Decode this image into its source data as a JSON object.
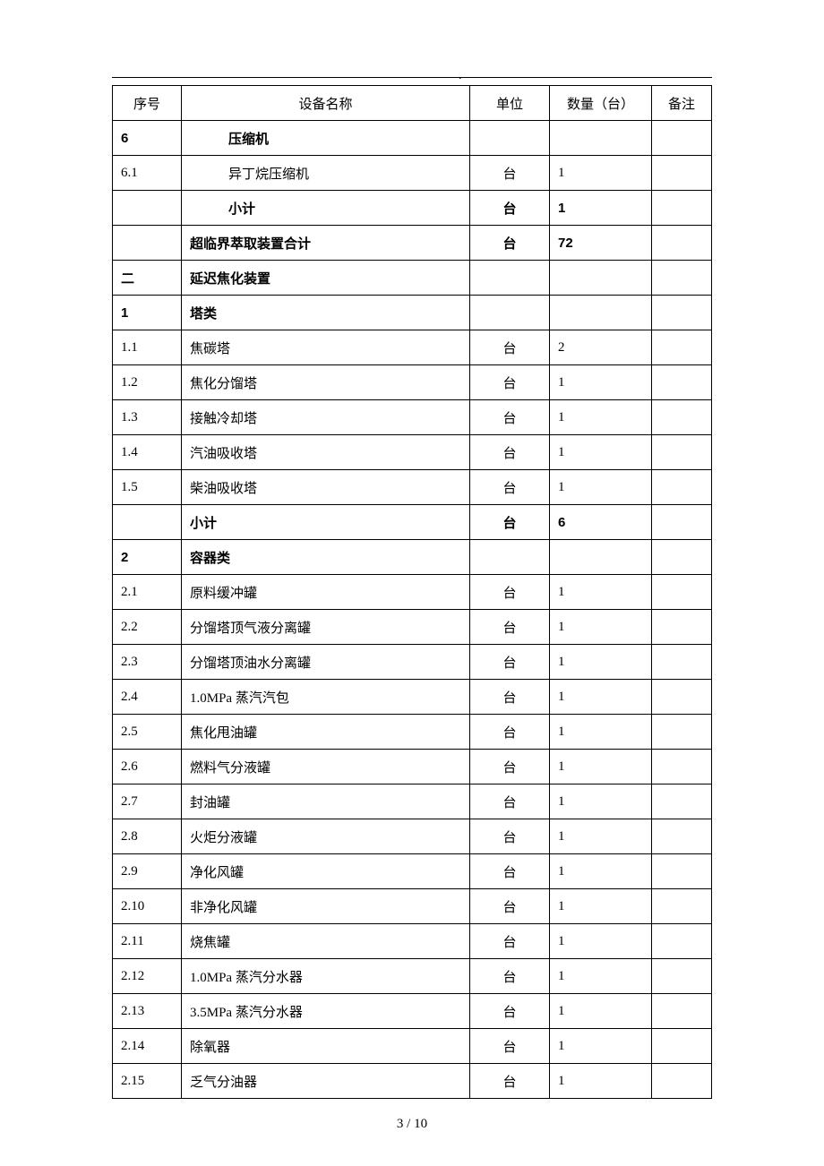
{
  "header_dot": ".",
  "columns": {
    "idx": "序号",
    "name": "设备名称",
    "unit": "单位",
    "qty": "数量（台）",
    "note": "备注"
  },
  "rows": [
    {
      "idx": "6",
      "name": "压缩机",
      "unit": "",
      "qty": "",
      "bold": true,
      "indent": true
    },
    {
      "idx": "6.1",
      "name": "异丁烷压缩机",
      "unit": "台",
      "qty": "1",
      "bold": false,
      "indent": true
    },
    {
      "idx": "",
      "name": "小计",
      "unit": "台",
      "qty": "1",
      "bold": true,
      "indent": true
    },
    {
      "idx": "",
      "name": "超临界萃取装置合计",
      "unit": "台",
      "qty": "72",
      "bold": true,
      "indent": false
    },
    {
      "idx": "二",
      "name": "延迟焦化装置",
      "unit": "",
      "qty": "",
      "bold": true,
      "indent": false
    },
    {
      "idx": "1",
      "name": "塔类",
      "unit": "",
      "qty": "",
      "bold": true,
      "indent": false
    },
    {
      "idx": "1.1",
      "name": "焦碳塔",
      "unit": "台",
      "qty": "2",
      "bold": false,
      "indent": false
    },
    {
      "idx": "1.2",
      "name": "焦化分馏塔",
      "unit": "台",
      "qty": "1",
      "bold": false,
      "indent": false
    },
    {
      "idx": "1.3",
      "name": "接触冷却塔",
      "unit": "台",
      "qty": "1",
      "bold": false,
      "indent": false
    },
    {
      "idx": "1.4",
      "name": "汽油吸收塔",
      "unit": "台",
      "qty": "1",
      "bold": false,
      "indent": false
    },
    {
      "idx": "1.5",
      "name": "柴油吸收塔",
      "unit": "台",
      "qty": "1",
      "bold": false,
      "indent": false
    },
    {
      "idx": "",
      "name": "小计",
      "unit": "台",
      "qty": "6",
      "bold": true,
      "indent": false
    },
    {
      "idx": "2",
      "name": "容器类",
      "unit": "",
      "qty": "",
      "bold": true,
      "indent": false
    },
    {
      "idx": "2.1",
      "name": "原料缓冲罐",
      "unit": "台",
      "qty": "1",
      "bold": false,
      "indent": false
    },
    {
      "idx": "2.2",
      "name": "分馏塔顶气液分离罐",
      "unit": "台",
      "qty": "1",
      "bold": false,
      "indent": false
    },
    {
      "idx": "2.3",
      "name": "分馏塔顶油水分离罐",
      "unit": "台",
      "qty": "1",
      "bold": false,
      "indent": false
    },
    {
      "idx": "2.4",
      "name": "1.0MPa 蒸汽汽包",
      "unit": "台",
      "qty": "1",
      "bold": false,
      "indent": false
    },
    {
      "idx": "2.5",
      "name": "焦化甩油罐",
      "unit": "台",
      "qty": "1",
      "bold": false,
      "indent": false
    },
    {
      "idx": "2.6",
      "name": "燃料气分液罐",
      "unit": "台",
      "qty": "1",
      "bold": false,
      "indent": false
    },
    {
      "idx": "2.7",
      "name": "封油罐",
      "unit": "台",
      "qty": "1",
      "bold": false,
      "indent": false
    },
    {
      "idx": "2.8",
      "name": "火炬分液罐",
      "unit": "台",
      "qty": "1",
      "bold": false,
      "indent": false
    },
    {
      "idx": "2.9",
      "name": "净化风罐",
      "unit": "台",
      "qty": "1",
      "bold": false,
      "indent": false
    },
    {
      "idx": "2.10",
      "name": "非净化风罐",
      "unit": "台",
      "qty": "1",
      "bold": false,
      "indent": false
    },
    {
      "idx": "2.11",
      "name": "烧焦罐",
      "unit": "台",
      "qty": "1",
      "bold": false,
      "indent": false
    },
    {
      "idx": "2.12",
      "name": "1.0MPa 蒸汽分水器",
      "unit": "台",
      "qty": "1",
      "bold": false,
      "indent": false
    },
    {
      "idx": "2.13",
      "name": "3.5MPa 蒸汽分水器",
      "unit": "台",
      "qty": "1",
      "bold": false,
      "indent": false
    },
    {
      "idx": "2.14",
      "name": "除氧器",
      "unit": "台",
      "qty": "1",
      "bold": false,
      "indent": false
    },
    {
      "idx": "2.15",
      "name": "乏气分油器",
      "unit": "台",
      "qty": "1",
      "bold": false,
      "indent": false
    }
  ],
  "footer": "3 / 10"
}
